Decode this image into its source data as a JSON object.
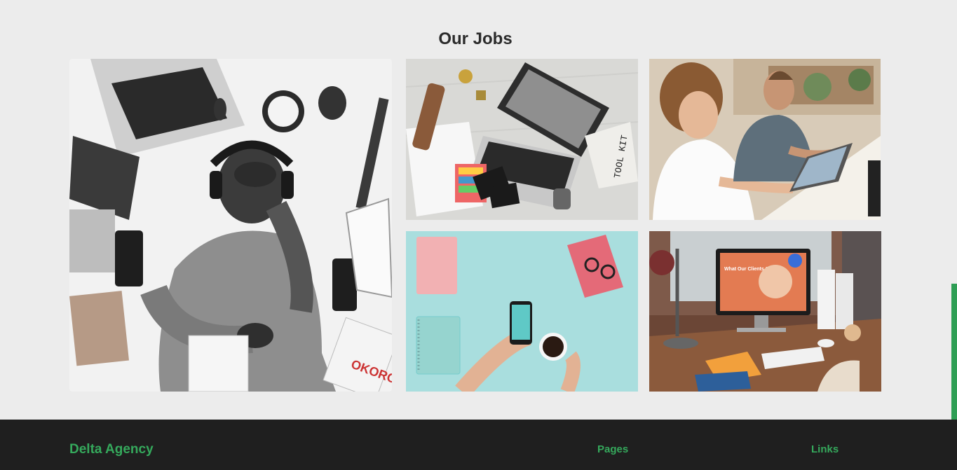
{
  "jobs": {
    "title": "Our Jobs",
    "gallery": [
      {
        "subject": "man-with-headphones-on-bed-with-gadgets"
      },
      {
        "subject": "laptop-with-sketch-and-toolkit-desk"
      },
      {
        "subject": "people-working-on-laptops-in-cafe"
      },
      {
        "subject": "hands-holding-phone-and-coffee-on-mint-desk"
      },
      {
        "subject": "desktop-computer-on-wooden-desk"
      }
    ]
  },
  "photo_text": {
    "monitor_heading": "What Our Clients Say",
    "toolkit_bag": "TOOL KIT",
    "magazine": "OKORO"
  },
  "footer": {
    "brand": "Delta Agency",
    "headings": {
      "pages": "Pages",
      "links": "Links"
    }
  },
  "colors": {
    "page_bg": "#ececec",
    "footer_bg": "#1f1f1f",
    "accent_green": "#35a95c",
    "title_text": "#2b2b2b"
  }
}
